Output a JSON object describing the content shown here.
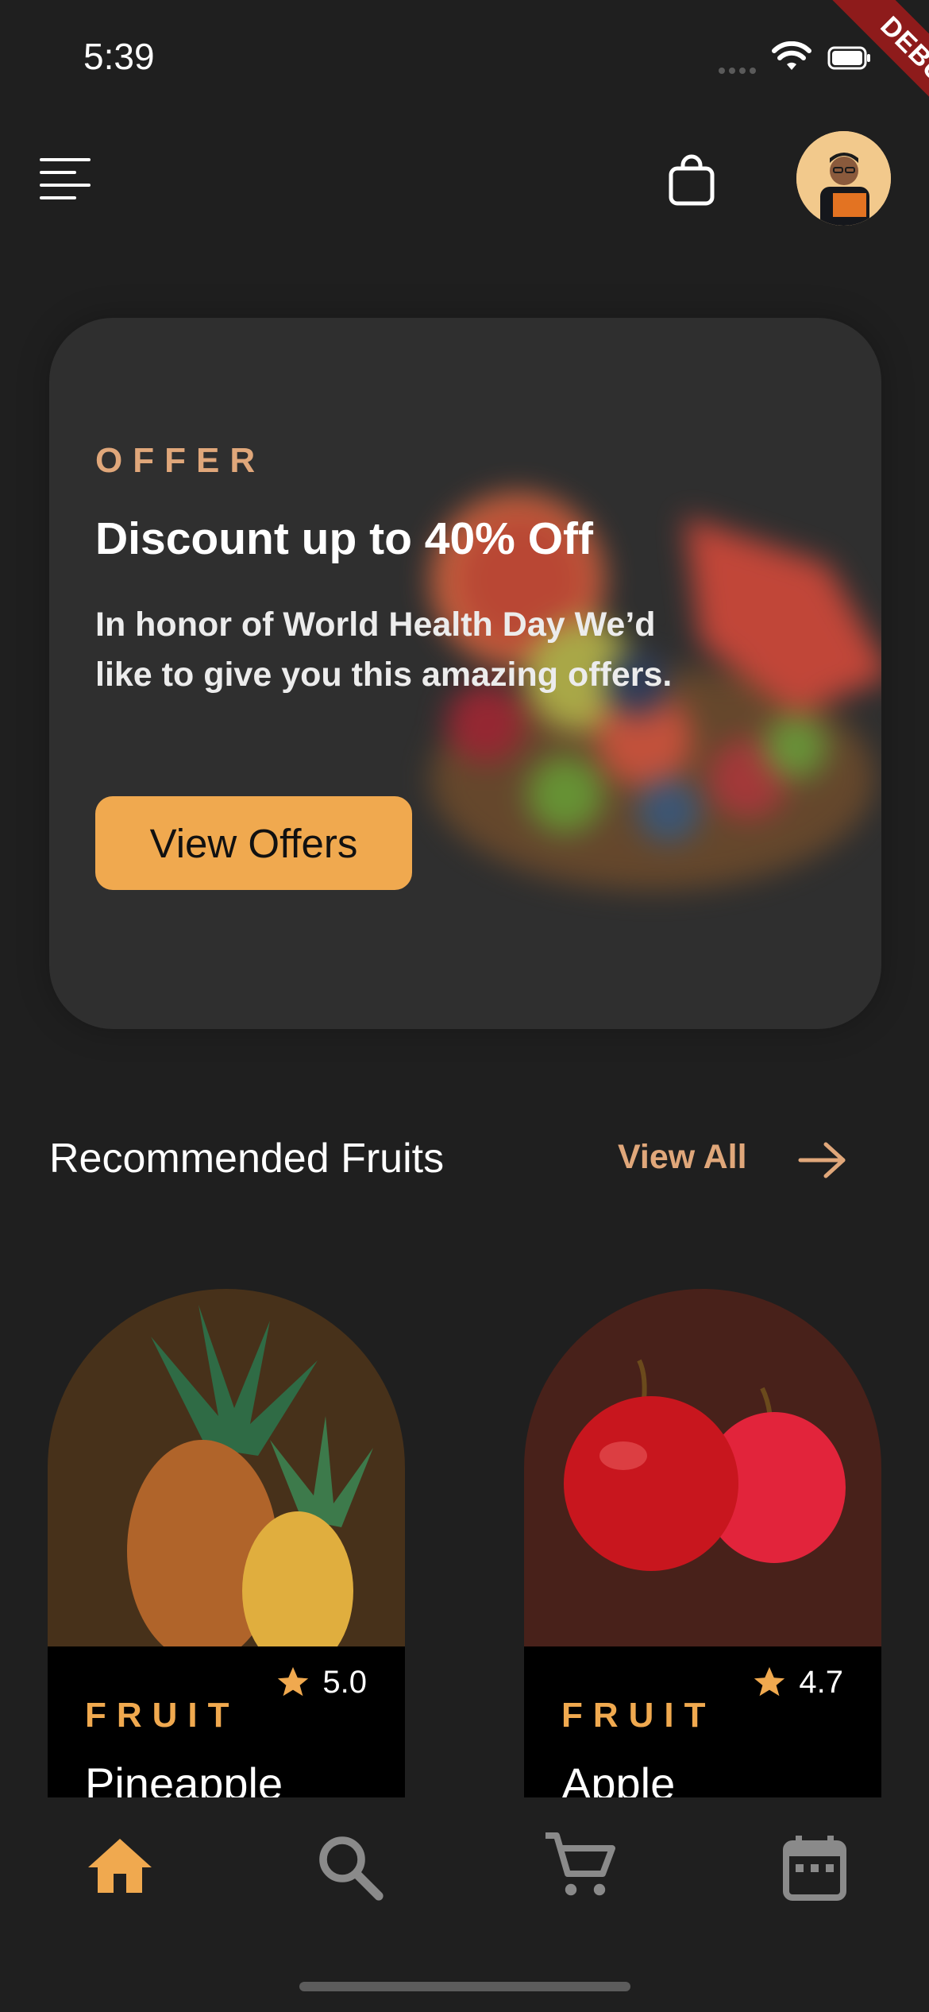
{
  "status_bar": {
    "time": "5:39",
    "debug_label": "DEBUG"
  },
  "header": {
    "menu_icon": "menu-icon",
    "bag_icon": "shopping-bag-icon",
    "avatar_icon": "avatar"
  },
  "offer": {
    "eyebrow": "OFFER",
    "title": "Discount up to 40% Off",
    "description": "In honor of World Health Day We’d like to give you this amazing offers.",
    "button_label": "View Offers"
  },
  "recommended": {
    "title": "Recommended Fruits",
    "view_all_label": "View All",
    "items": [
      {
        "category": "FRUIT",
        "name": "Pineapple",
        "rating": "5.0",
        "bg_color": "#47311a"
      },
      {
        "category": "FRUIT",
        "name": "Apple",
        "rating": "4.7",
        "bg_color": "#48211a"
      }
    ]
  },
  "bottom_nav": {
    "items": [
      {
        "icon": "home-icon",
        "active": true
      },
      {
        "icon": "search-icon",
        "active": false
      },
      {
        "icon": "cart-icon",
        "active": false
      },
      {
        "icon": "calendar-icon",
        "active": false
      }
    ]
  },
  "colors": {
    "accent": "#f0a94f",
    "muted_accent": "#e0a77a",
    "background": "#1f1f1f",
    "card": "#2f2f2f"
  }
}
